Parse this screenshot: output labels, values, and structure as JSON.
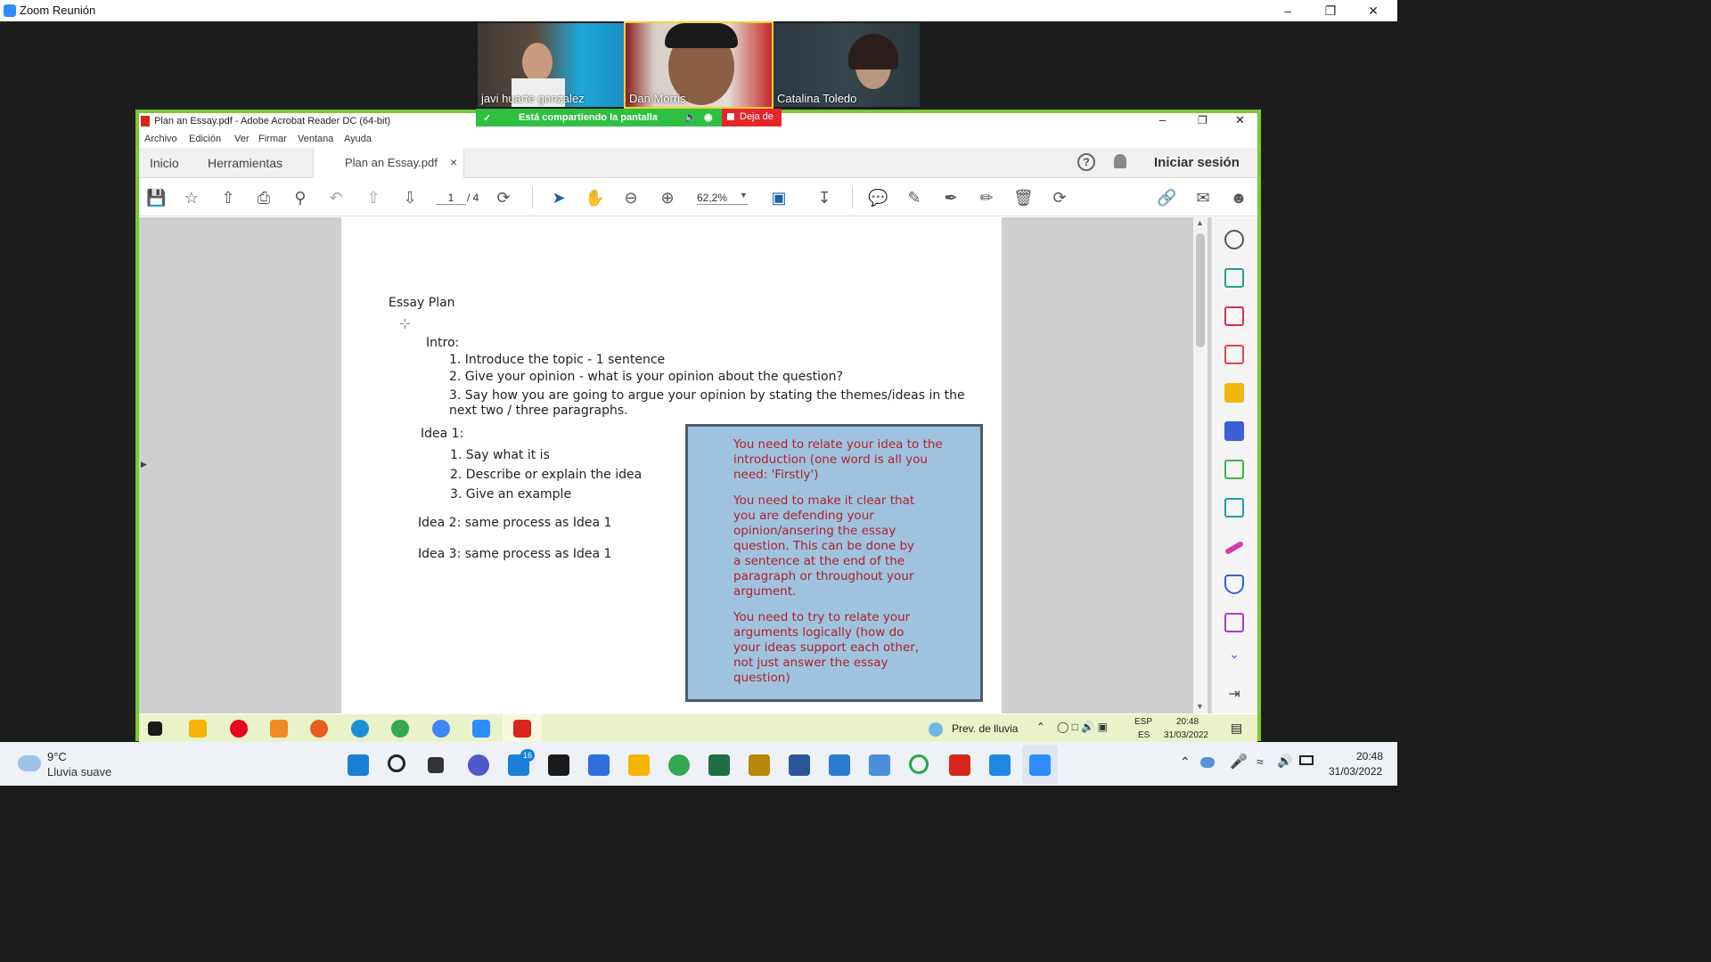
{
  "zoom": {
    "window_title": "Zoom Reunión",
    "participants": [
      {
        "name": "javi huarte gonzalez"
      },
      {
        "name": "Dan Morris"
      },
      {
        "name": "Catalina Toledo"
      }
    ],
    "share_banner": "Está compartiendo la pantalla",
    "stop_share": "Deja de"
  },
  "acrobat": {
    "window_title": "Plan an Essay.pdf - Adobe Acrobat Reader DC (64-bit)",
    "menu": [
      "Archivo",
      "Edición",
      "Ver",
      "Firmar",
      "Ventana",
      "Ayuda"
    ],
    "tabs": {
      "home": "Inicio",
      "tools": "Herramientas",
      "document": "Plan an Essay.pdf",
      "close": "×"
    },
    "sign_in": "Iniciar sesión",
    "help": "?",
    "page_current": "1",
    "page_total": "/ 4",
    "zoom_level": "62,2%"
  },
  "document": {
    "title": "Essay Plan",
    "intro_heading": "Intro:",
    "intro_items": [
      "1. Introduce the topic - 1 sentence",
      "2. Give your opinion - what is your opinion about the question?",
      "3. Say how you are going to argue your opinion  by stating the themes/ideas in the",
      "next two / three paragraphs."
    ],
    "idea1_heading": "Idea 1:",
    "idea1_items": [
      "1. Say what it is",
      "2. Describe or explain the idea",
      "3. Give an example"
    ],
    "idea2": "Idea 2: same process as Idea 1",
    "idea3": "Idea 3: same process as Idea 1",
    "callout": [
      "You need to relate your idea to the\nintroduction (one word is all you\nneed: 'Firstly')",
      "You need to make it clear that\nyou are defending your\nopinion/ansering the essay\nquestion. This can be done by\na sentence at the end of the\nparagraph or throughout your\nargument.",
      "You need to try to relate your\narguments logically (how do\nyour ideas support each other,\nnot just answer the essay\nquestion)"
    ]
  },
  "inner_taskbar": {
    "weather": "Prev. de lluvia",
    "lang_top": "ESP",
    "lang_bottom": "ES",
    "time": "20:48",
    "date": "31/03/2022"
  },
  "taskbar": {
    "temperature": "9°C",
    "weather": "Lluvia suave",
    "mail_badge": "16",
    "time": "20:48",
    "date": "31/03/2022"
  }
}
